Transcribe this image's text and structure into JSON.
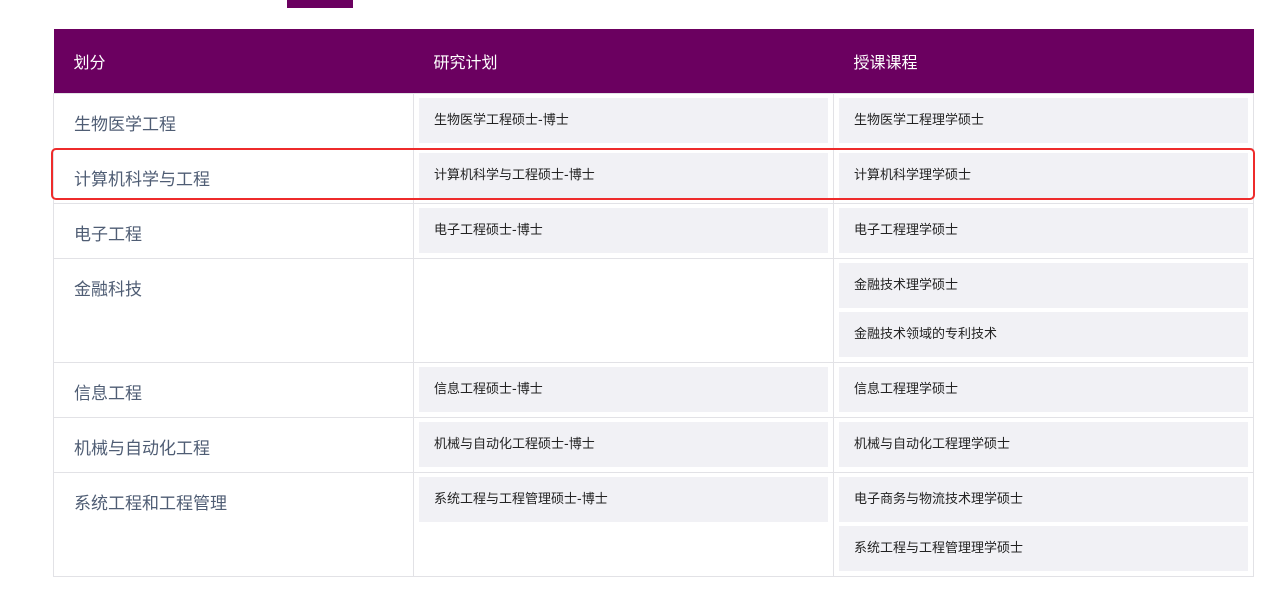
{
  "theme": {
    "accent": "#6b0060",
    "highlight": "#ee2b2b"
  },
  "table": {
    "headers": [
      "划分",
      "研究计划",
      "授课课程"
    ],
    "rows": [
      {
        "division": "生物医学工程",
        "research": [
          "生物医学工程硕士-博士"
        ],
        "taught": [
          "生物医学工程理学硕士"
        ]
      },
      {
        "division": "计算机科学与工程",
        "research": [
          "计算机科学与工程硕士-博士"
        ],
        "taught": [
          "计算机科学理学硕士"
        ]
      },
      {
        "division": "电子工程",
        "research": [
          "电子工程硕士-博士"
        ],
        "taught": [
          "电子工程理学硕士"
        ]
      },
      {
        "division": "金融科技",
        "research": [],
        "taught": [
          "金融技术理学硕士",
          "金融技术领域的专利技术"
        ]
      },
      {
        "division": "信息工程",
        "research": [
          "信息工程硕士-博士"
        ],
        "taught": [
          "信息工程理学硕士"
        ]
      },
      {
        "division": "机械与自动化工程",
        "research": [
          "机械与自动化工程硕士-博士"
        ],
        "taught": [
          "机械与自动化工程理学硕士"
        ]
      },
      {
        "division": "系统工程和工程管理",
        "research": [
          "系统工程与工程管理硕士-博士"
        ],
        "taught": [
          "电子商务与物流技术理学硕士",
          "系统工程与工程管理理学硕士"
        ]
      }
    ]
  }
}
